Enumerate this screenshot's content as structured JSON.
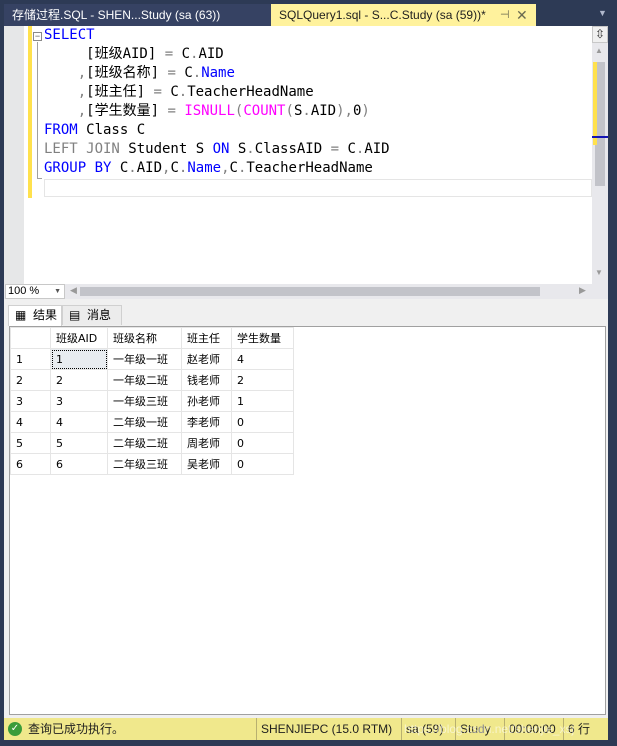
{
  "tabs": [
    {
      "label": "存储过程.SQL - SHEN...Study (sa (63))",
      "active": false
    },
    {
      "label": "SQLQuery1.sql - S...C.Study (sa (59))*",
      "active": true
    }
  ],
  "tab_icons": {
    "pin": "⊣",
    "close": "✕",
    "overflow": "▼"
  },
  "editor": {
    "lines": [
      [
        {
          "t": "SELECT",
          "c": "kw"
        }
      ],
      [
        {
          "t": "     [班级AID] ",
          "c": ""
        },
        {
          "t": "=",
          "c": "gray"
        },
        {
          "t": " C",
          "c": ""
        },
        {
          "t": ".",
          "c": "gray"
        },
        {
          "t": "AID",
          "c": ""
        }
      ],
      [
        {
          "t": "    ",
          "c": ""
        },
        {
          "t": ",",
          "c": "gray"
        },
        {
          "t": "[班级名称] ",
          "c": ""
        },
        {
          "t": "=",
          "c": "gray"
        },
        {
          "t": " C",
          "c": ""
        },
        {
          "t": ".",
          "c": "gray"
        },
        {
          "t": "Name",
          "c": "kw"
        }
      ],
      [
        {
          "t": "    ",
          "c": ""
        },
        {
          "t": ",",
          "c": "gray"
        },
        {
          "t": "[班主任] ",
          "c": ""
        },
        {
          "t": "=",
          "c": "gray"
        },
        {
          "t": " C",
          "c": ""
        },
        {
          "t": ".",
          "c": "gray"
        },
        {
          "t": "TeacherHeadName",
          "c": ""
        }
      ],
      [
        {
          "t": "    ",
          "c": ""
        },
        {
          "t": ",",
          "c": "gray"
        },
        {
          "t": "[学生数量] ",
          "c": ""
        },
        {
          "t": "=",
          "c": "gray"
        },
        {
          "t": " ",
          "c": ""
        },
        {
          "t": "ISNULL",
          "c": "fn"
        },
        {
          "t": "(",
          "c": "gray"
        },
        {
          "t": "COUNT",
          "c": "fn"
        },
        {
          "t": "(",
          "c": "gray"
        },
        {
          "t": "S",
          "c": ""
        },
        {
          "t": ".",
          "c": "gray"
        },
        {
          "t": "AID",
          "c": ""
        },
        {
          "t": "),",
          "c": "gray"
        },
        {
          "t": "0",
          "c": ""
        },
        {
          "t": ")",
          "c": "gray"
        }
      ],
      [
        {
          "t": "FROM",
          "c": "kw"
        },
        {
          "t": " Class C",
          "c": ""
        }
      ],
      [
        {
          "t": "LEFT JOIN",
          "c": "gray"
        },
        {
          "t": " Student S ",
          "c": ""
        },
        {
          "t": "ON",
          "c": "kw"
        },
        {
          "t": " S",
          "c": ""
        },
        {
          "t": ".",
          "c": "gray"
        },
        {
          "t": "ClassAID ",
          "c": ""
        },
        {
          "t": "=",
          "c": "gray"
        },
        {
          "t": " C",
          "c": ""
        },
        {
          "t": ".",
          "c": "gray"
        },
        {
          "t": "AID",
          "c": ""
        }
      ],
      [
        {
          "t": "GROUP BY",
          "c": "kw"
        },
        {
          "t": " C",
          "c": ""
        },
        {
          "t": ".",
          "c": "gray"
        },
        {
          "t": "AID",
          "c": ""
        },
        {
          "t": ",",
          "c": "gray"
        },
        {
          "t": "C",
          "c": ""
        },
        {
          "t": ".",
          "c": "gray"
        },
        {
          "t": "Name",
          "c": "kw"
        },
        {
          "t": ",",
          "c": "gray"
        },
        {
          "t": "C",
          "c": ""
        },
        {
          "t": ".",
          "c": "gray"
        },
        {
          "t": "TeacherHeadName",
          "c": ""
        }
      ]
    ]
  },
  "zoom": {
    "value": "100 %"
  },
  "results_tabs": [
    {
      "label": "结果",
      "icon": "grid-icon",
      "active": true
    },
    {
      "label": "消息",
      "icon": "messages-icon",
      "active": false
    }
  ],
  "grid": {
    "columns": [
      "",
      "班级AID",
      "班级名称",
      "班主任",
      "学生数量"
    ],
    "rows": [
      [
        "1",
        "1",
        "一年级一班",
        "赵老师",
        "4"
      ],
      [
        "2",
        "2",
        "一年级二班",
        "钱老师",
        "2"
      ],
      [
        "3",
        "3",
        "一年级三班",
        "孙老师",
        "1"
      ],
      [
        "4",
        "4",
        "二年级一班",
        "李老师",
        "0"
      ],
      [
        "5",
        "5",
        "二年级二班",
        "周老师",
        "0"
      ],
      [
        "6",
        "6",
        "二年级三班",
        "吴老师",
        "0"
      ]
    ]
  },
  "status": {
    "message": "查询已成功执行。",
    "server": "SHENJIEPC (15.0 RTM)",
    "user": "sa (59)",
    "database": "Study",
    "elapsed": "00:00:00",
    "rows": "6 行",
    "watermark": "https://blog.csdn.net/shenjie_xsj"
  },
  "colors": {
    "active_tab": "#fff29d",
    "status_bar": "#f0e88c",
    "keyword": "#0000ff",
    "function": "#ff00ff",
    "chrome": "#2d3a55"
  }
}
